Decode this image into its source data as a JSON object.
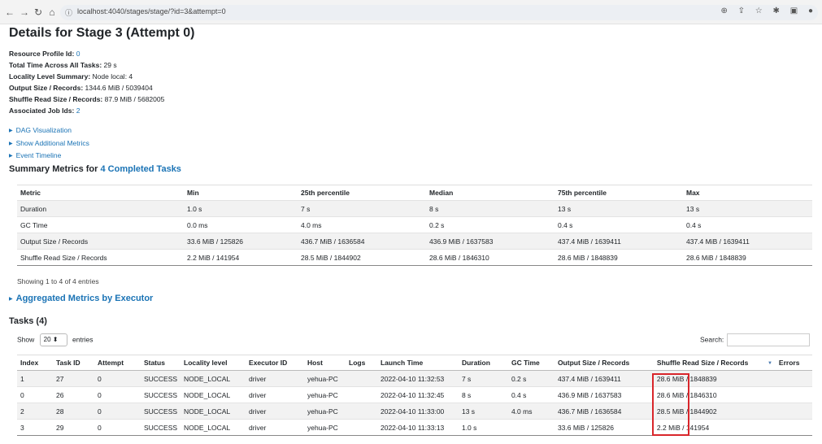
{
  "browser": {
    "url": "localhost:4040/stages/stage/?id=3&attempt=0",
    "nav": {
      "back": "←",
      "forward": "→",
      "reload": "↻",
      "home": "⌂"
    },
    "lock": "ⓘ",
    "icons": [
      "zoom-icon",
      "share-icon",
      "star-icon",
      "extensions-icon",
      "sidebar-icon",
      "profile-icon"
    ]
  },
  "page": {
    "title": "Details for Stage 3 (Attempt 0)",
    "summary": [
      {
        "label": "Resource Profile Id:",
        "value": "0",
        "link": true
      },
      {
        "label": "Total Time Across All Tasks:",
        "value": "29 s",
        "link": false
      },
      {
        "label": "Locality Level Summary:",
        "value": "Node local: 4",
        "link": false
      },
      {
        "label": "Output Size / Records:",
        "value": "1344.6 MiB / 5039404",
        "link": false
      },
      {
        "label": "Shuffle Read Size / Records:",
        "value": "87.9 MiB / 5682005",
        "link": false
      },
      {
        "label": "Associated Job Ids:",
        "value": "2",
        "link": true
      }
    ],
    "toggles": [
      "DAG Visualization",
      "Show Additional Metrics",
      "Event Timeline"
    ],
    "summary_metrics": {
      "heading_prefix": "Summary Metrics for ",
      "heading_link": "4 Completed Tasks",
      "columns": [
        "Metric",
        "Min",
        "25th percentile",
        "Median",
        "75th percentile",
        "Max"
      ],
      "rows": [
        [
          "Duration",
          "1.0 s",
          "7 s",
          "8 s",
          "13 s",
          "13 s"
        ],
        [
          "GC Time",
          "0.0 ms",
          "4.0 ms",
          "0.2 s",
          "0.4 s",
          "0.4 s"
        ],
        [
          "Output Size / Records",
          "33.6 MiB / 125826",
          "436.7 MiB / 1636584",
          "436.9 MiB / 1637583",
          "437.4 MiB / 1639411",
          "437.4 MiB / 1639411"
        ],
        [
          "Shuffle Read Size / Records",
          "2.2 MiB / 141954",
          "28.5 MiB / 1844902",
          "28.6 MiB / 1846310",
          "28.6 MiB / 1848839",
          "28.6 MiB / 1848839"
        ]
      ],
      "showing": "Showing 1 to 4 of 4 entries"
    },
    "aggregated_link": "Aggregated Metrics by Executor",
    "tasks": {
      "heading": "Tasks (4)",
      "show_label": "Show",
      "page_size": "20",
      "entries_label": "entries",
      "search_label": "Search:",
      "search_value": "",
      "columns": [
        "Index",
        "Task ID",
        "Attempt",
        "Status",
        "Locality level",
        "Executor ID",
        "Host",
        "Logs",
        "Launch Time",
        "Duration",
        "GC Time",
        "Output Size / Records",
        "Shuffle Read Size / Records",
        "Errors"
      ],
      "rows": [
        [
          "1",
          "27",
          "0",
          "SUCCESS",
          "NODE_LOCAL",
          "driver",
          "yehua-PC",
          "",
          "2022-04-10 11:32:53",
          "7 s",
          "0.2 s",
          "437.4 MiB / 1639411",
          "28.6 MiB / 1848839",
          ""
        ],
        [
          "0",
          "26",
          "0",
          "SUCCESS",
          "NODE_LOCAL",
          "driver",
          "yehua-PC",
          "",
          "2022-04-10 11:32:45",
          "8 s",
          "0.4 s",
          "436.9 MiB / 1637583",
          "28.6 MiB / 1846310",
          ""
        ],
        [
          "2",
          "28",
          "0",
          "SUCCESS",
          "NODE_LOCAL",
          "driver",
          "yehua-PC",
          "",
          "2022-04-10 11:33:00",
          "13 s",
          "4.0 ms",
          "436.7 MiB / 1636584",
          "28.5 MiB / 1844902",
          ""
        ],
        [
          "3",
          "29",
          "0",
          "SUCCESS",
          "NODE_LOCAL",
          "driver",
          "yehua-PC",
          "",
          "2022-04-10 11:33:13",
          "1.0 s",
          "",
          "33.6 MiB / 125826",
          "2.2 MiB / 141954",
          ""
        ]
      ],
      "sort_indicator": "▼"
    }
  }
}
